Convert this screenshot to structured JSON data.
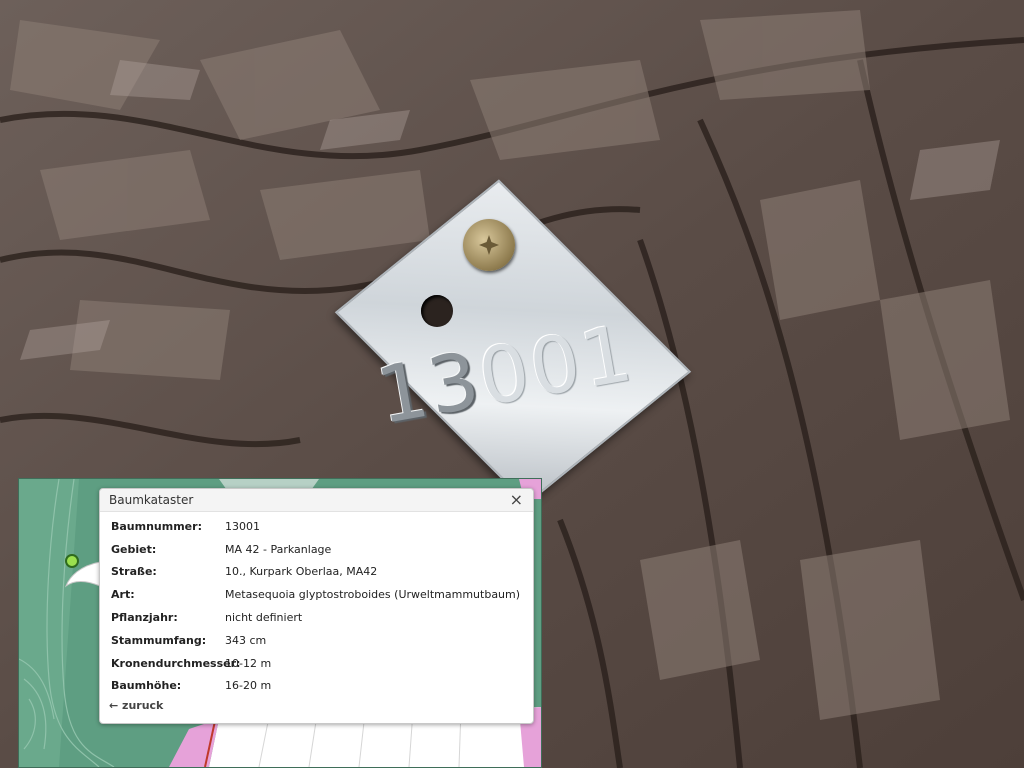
{
  "tag": {
    "number_part1": "13",
    "number_part2": "001"
  },
  "popup": {
    "title": "Baumkataster",
    "close_icon": "close-icon",
    "rows": [
      {
        "label": "Baumnummer:",
        "value": "13001"
      },
      {
        "label": "Gebiet:",
        "value": "MA 42 - Parkanlage"
      },
      {
        "label": "Straße:",
        "value": "10., Kurpark Oberlaa, MA42"
      },
      {
        "label": "Art:",
        "value": "Metasequoia glyptostroboides (Urweltmammutbaum)"
      },
      {
        "label": "Pflanzjahr:",
        "value": "nicht definiert"
      },
      {
        "label": "Stammumfang:",
        "value": "343 cm"
      },
      {
        "label": "Kronendurchmesser:",
        "value": "10-12 m"
      },
      {
        "label": "Baumhöhe:",
        "value": "16-20 m"
      }
    ],
    "back_label": "← zuruck"
  },
  "colors": {
    "map_green": "#5e9e82",
    "map_pink": "#e6a2d9",
    "marker": "#9be04f"
  }
}
